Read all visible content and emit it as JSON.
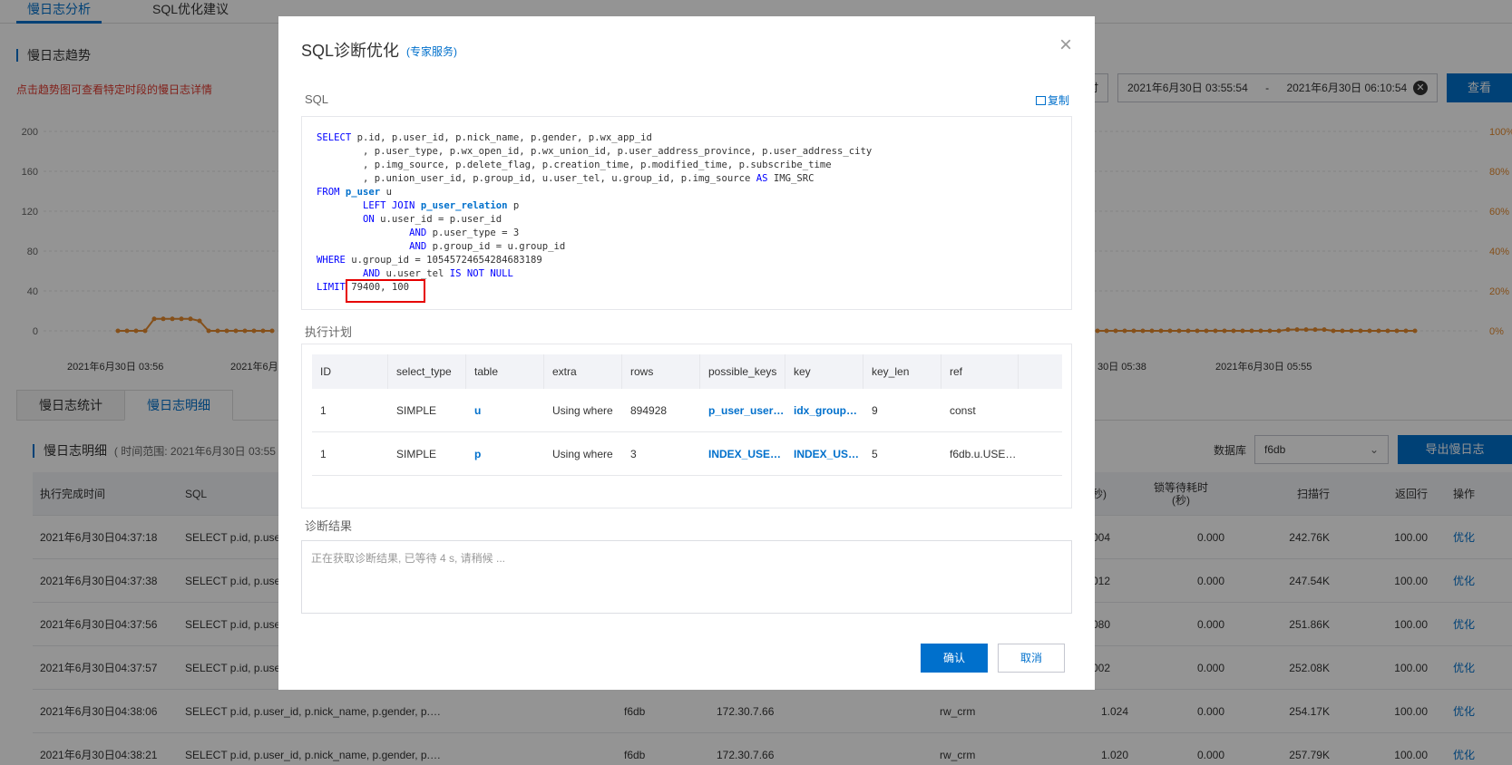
{
  "tabs": [
    "慢日志分析",
    "SQL优化建议"
  ],
  "trend_title": "慢日志趋势",
  "trend_hint": "点击趋势图可查看特定时段的慢日志详情",
  "range_left_fragment": "时",
  "start_time": "2021年6月30日 03:55:54",
  "range_sep": "-",
  "end_time": "2021年6月30日 06:10:54",
  "query_button": "查看",
  "chart_data": {
    "type": "line",
    "y_left_ticks": [
      "200",
      "160",
      "120",
      "80",
      "40",
      "0"
    ],
    "y_right_ticks": [
      "100%",
      "80%",
      "60%",
      "40%",
      "20%",
      "0%"
    ],
    "x_ticks": [
      "2021年6月30日 03:56",
      "2021年6月",
      "30日 05:38",
      "2021年6月30日 05:55"
    ],
    "ylim": [
      0,
      200
    ],
    "line_color": "#e68a2e"
  },
  "subtabs": [
    "慢日志统计",
    "慢日志明细"
  ],
  "detail_title": "慢日志明细",
  "detail_range": "( 时间范围: 2021年6月30日 03:55 -",
  "db_label": "数据库",
  "db_value": "f6db",
  "export_button": "导出慢日志",
  "table": {
    "headers": [
      "执行完成时间",
      "SQL",
      "秒)",
      "锁等待耗时\n(秒)",
      "扫描行",
      "返回行",
      "操作"
    ],
    "rows": [
      {
        "time": "2021年6月30日04:37:18",
        "sql": "SELECT p.id, p.use",
        "db": "",
        "ip": "",
        "user": "",
        "dur": "004",
        "lock": "0.000",
        "scan": "242.76K",
        "ret": "100.00",
        "op": "优化"
      },
      {
        "time": "2021年6月30日04:37:38",
        "sql": "SELECT p.id, p.use",
        "db": "",
        "ip": "",
        "user": "",
        "dur": "012",
        "lock": "0.000",
        "scan": "247.54K",
        "ret": "100.00",
        "op": "优化"
      },
      {
        "time": "2021年6月30日04:37:56",
        "sql": "SELECT p.id, p.use",
        "db": "",
        "ip": "",
        "user": "",
        "dur": "080",
        "lock": "0.000",
        "scan": "251.86K",
        "ret": "100.00",
        "op": "优化"
      },
      {
        "time": "2021年6月30日04:37:57",
        "sql": "SELECT p.id, p.use",
        "db": "",
        "ip": "",
        "user": "",
        "dur": "002",
        "lock": "0.000",
        "scan": "252.08K",
        "ret": "100.00",
        "op": "优化"
      },
      {
        "time": "2021年6月30日04:38:06",
        "sql": "SELECT p.id, p.user_id, p.nick_name, p.gender, p.wx_app_id, p.user_type, p.wx_ope…",
        "db": "f6db",
        "ip": "172.30.7.66",
        "user": "rw_crm",
        "dur": "1.024",
        "lock": "0.000",
        "scan": "254.17K",
        "ret": "100.00",
        "op": "优化"
      },
      {
        "time": "2021年6月30日04:38:21",
        "sql": "SELECT p.id, p.user_id, p.nick_name, p.gender, p.wx_app_id, p.user_type, p.wx_ope…",
        "db": "f6db",
        "ip": "172.30.7.66",
        "user": "rw_crm",
        "dur": "1.020",
        "lock": "0.000",
        "scan": "257.79K",
        "ret": "100.00",
        "op": "优化"
      }
    ]
  },
  "modal": {
    "title": "SQL诊断优化",
    "subtitle": "(专家服务)",
    "sql_label": "SQL",
    "copy_label": "复制",
    "sql_lines": [
      "SELECT p.id, p.user_id, p.nick_name, p.gender, p.wx_app_id",
      "        , p.user_type, p.wx_open_id, p.wx_union_id, p.user_address_province, p.user_address_city",
      "        , p.img_source, p.delete_flag, p.creation_time, p.modified_time, p.subscribe_time",
      "        , p.union_user_id, p.group_id, u.user_tel, u.group_id, p.img_source AS IMG_SRC",
      "FROM p_user u",
      "        LEFT JOIN p_user_relation p",
      "        ON u.user_id = p.user_id",
      "                AND p.user_type = 3",
      "                AND p.group_id = u.group_id",
      "WHERE u.group_id = 10545724654284683189",
      "        AND u.user_tel IS NOT NULL",
      "LIMIT 79400, 100"
    ],
    "plan_label": "执行计划",
    "plan_headers": [
      "ID",
      "select_type",
      "table",
      "extra",
      "rows",
      "possible_keys",
      "key",
      "key_len",
      "ref"
    ],
    "plan_rows": [
      [
        "1",
        "SIMPLE",
        "u",
        "Using where",
        "894928",
        "p_user_user…",
        "idx_group…",
        "9",
        "const"
      ],
      [
        "1",
        "SIMPLE",
        "p",
        "Using where",
        "3",
        "INDEX_USE…",
        "INDEX_US…",
        "5",
        "f6db.u.USE…"
      ]
    ],
    "result_label": "诊断结果",
    "result_text": "正在获取诊断结果, 已等待 4 s, 请稍候 ...",
    "confirm": "确认",
    "cancel": "取消"
  }
}
